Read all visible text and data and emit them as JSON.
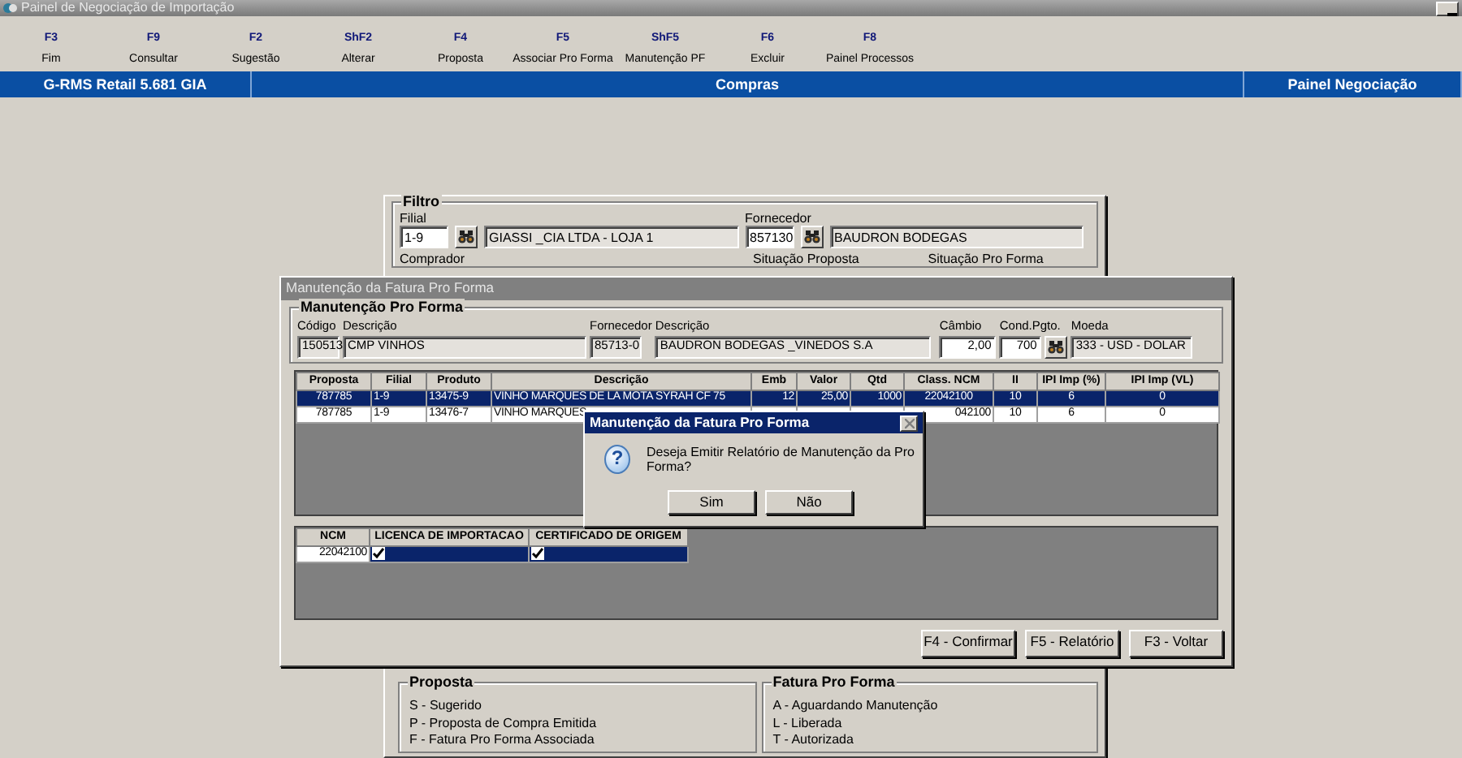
{
  "main_window": {
    "title": "Painel de Negociação de Importação"
  },
  "function_keys": [
    {
      "key": "F3",
      "label": "Fim"
    },
    {
      "key": "F9",
      "label": "Consultar"
    },
    {
      "key": "F2",
      "label": "Sugestão"
    },
    {
      "key": "ShF2",
      "label": "Alterar"
    },
    {
      "key": "F4",
      "label": "Proposta"
    },
    {
      "key": "F5",
      "label": "Associar Pro Forma"
    },
    {
      "key": "ShF5",
      "label": "Manutenção PF"
    },
    {
      "key": "F6",
      "label": "Excluir"
    },
    {
      "key": "F8",
      "label": "Painel Processos"
    }
  ],
  "status_bar": [
    "G-RMS Retail 5.681 GIA",
    "Compras",
    "Painel Negociação"
  ],
  "background_form": {
    "filter": {
      "legend": "Filtro",
      "fields": [
        {
          "label": "Filial",
          "code": "1-9",
          "description": "GIASSI _CIA LTDA - LOJA 1"
        },
        {
          "label": "Fornecedor",
          "code": "857130",
          "description": "BAUDRON BODEGAS"
        }
      ],
      "labels": [
        "Comprador",
        "Situação Proposta",
        "Situação Pro Forma"
      ]
    },
    "legends": [
      {
        "title": "Proposta",
        "items": [
          "S - Sugerido",
          "P - Proposta de Compra Emitida",
          "F - Fatura Pro Forma Associada"
        ]
      },
      {
        "title": "Fatura Pro Forma",
        "items": [
          "A - Aguardando Manutenção",
          "L - Liberada",
          "T - Autorizada"
        ]
      }
    ]
  },
  "dialog": {
    "title": "Manutenção da Fatura Pro Forma",
    "group": {
      "legend": "Manutenção Pro Forma",
      "fields": [
        {
          "label": "Código",
          "value": "150513",
          "editable": false,
          "lookup": false
        },
        {
          "label": "Descrição",
          "value": "CMP VINHOS",
          "editable": false,
          "lookup": false
        },
        {
          "label": "Fornecedor",
          "value": "85713-0",
          "editable": false,
          "lookup": false
        },
        {
          "label": "Descrição",
          "value": "BAUDRON BODEGAS _VINEDOS S.A",
          "editable": false,
          "lookup": false
        },
        {
          "label": "Câmbio",
          "value": "2,00",
          "editable": true,
          "lookup": false
        },
        {
          "label": "Cond.Pgto.",
          "value": "700",
          "editable": true,
          "lookup": true
        },
        {
          "label": "Moeda",
          "value": "333 - USD - DOLAR",
          "editable": false,
          "lookup": false
        }
      ]
    },
    "items_table": {
      "columns": [
        "Proposta",
        "Filial",
        "Produto",
        "Descrição",
        "Emb",
        "Valor",
        "Qtd",
        "Class. NCM",
        "II",
        "IPI Imp (%)",
        "IPI Imp (VL)"
      ],
      "rows": [
        {
          "selected": true,
          "cells": [
            "787785",
            "1-9",
            "13475-9",
            "VINHO MARQUES DE LA MOTA SYRAH  CF 75",
            "12",
            "25,00",
            "1000",
            "22042100",
            "10",
            "6",
            "0"
          ]
        },
        {
          "selected": false,
          "cells": [
            "787785",
            "1-9",
            "13476-7",
            "VINHO MARQUES",
            null,
            null,
            null,
            "042100",
            "10",
            "6",
            "0"
          ]
        }
      ]
    },
    "ncm_table": {
      "columns": [
        "NCM",
        "LICENCA DE IMPORTACAO",
        "CERTIFICADO DE ORIGEM"
      ],
      "rows": [
        {
          "ncm": "22042100",
          "checks": [
            true,
            true
          ]
        }
      ]
    },
    "buttons": [
      "F4 - Confirmar",
      "F5 - Relatório",
      "F3 - Voltar"
    ]
  },
  "message_box": {
    "title": "Manutenção da Fatura Pro Forma",
    "icon_glyph": "?",
    "message": "Deseja Emitir Relatório de Manutenção da Pro Forma?",
    "buttons": [
      "Sim",
      "Não"
    ]
  }
}
